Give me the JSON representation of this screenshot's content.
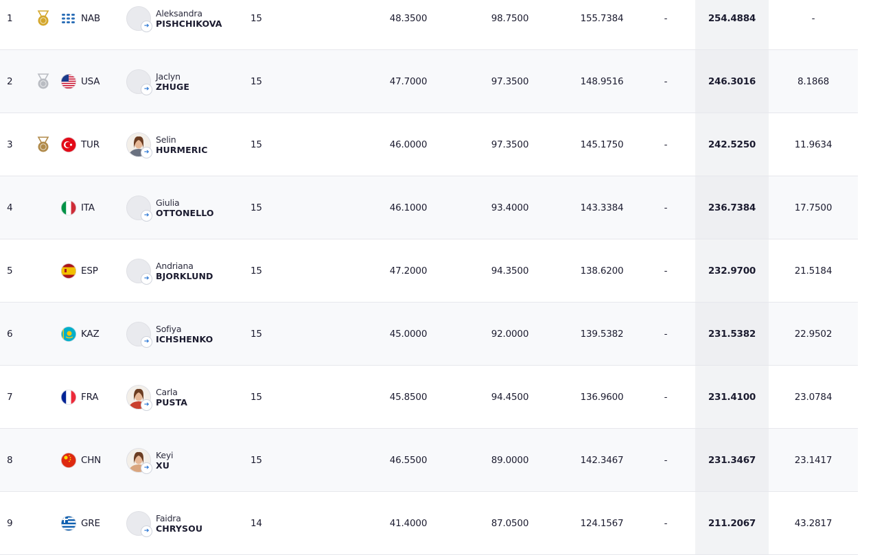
{
  "columns": [
    "rank",
    "medal",
    "noc",
    "athlete",
    "age",
    "score1",
    "score2",
    "score3",
    "penalty",
    "total",
    "behind"
  ],
  "rows": [
    {
      "rank": "1",
      "medal": "gold",
      "noc": "NAB",
      "flag": "nab-flag-icon",
      "first": "Aleksandra",
      "last": "PISHCHIKOVA",
      "age": "15",
      "s1": "48.3500",
      "s2": "98.7500",
      "s3": "155.7384",
      "pen": "-",
      "total": "254.4884",
      "behind": "-",
      "photo": false
    },
    {
      "rank": "2",
      "medal": "silver",
      "noc": "USA",
      "flag": "usa-flag-icon",
      "first": "Jaclyn",
      "last": "ZHUGE",
      "age": "15",
      "s1": "47.7000",
      "s2": "97.3500",
      "s3": "148.9516",
      "pen": "-",
      "total": "246.3016",
      "behind": "8.1868",
      "photo": false
    },
    {
      "rank": "3",
      "medal": "bronze",
      "noc": "TUR",
      "flag": "tur-flag-icon",
      "first": "Selin",
      "last": "HURMERIC",
      "age": "15",
      "s1": "46.0000",
      "s2": "97.3500",
      "s3": "145.1750",
      "pen": "-",
      "total": "242.5250",
      "behind": "11.9634",
      "photo": true
    },
    {
      "rank": "4",
      "medal": "",
      "noc": "ITA",
      "flag": "ita-flag-icon",
      "first": "Giulia",
      "last": "OTTONELLO",
      "age": "15",
      "s1": "46.1000",
      "s2": "93.4000",
      "s3": "143.3384",
      "pen": "-",
      "total": "236.7384",
      "behind": "17.7500",
      "photo": false
    },
    {
      "rank": "5",
      "medal": "",
      "noc": "ESP",
      "flag": "esp-flag-icon",
      "first": "Andriana",
      "last": "BJORKLUND",
      "age": "15",
      "s1": "47.2000",
      "s2": "94.3500",
      "s3": "138.6200",
      "pen": "-",
      "total": "232.9700",
      "behind": "21.5184",
      "photo": false
    },
    {
      "rank": "6",
      "medal": "",
      "noc": "KAZ",
      "flag": "kaz-flag-icon",
      "first": "Sofiya",
      "last": "ICHSHENKO",
      "age": "15",
      "s1": "45.0000",
      "s2": "92.0000",
      "s3": "139.5382",
      "pen": "-",
      "total": "231.5382",
      "behind": "22.9502",
      "photo": false
    },
    {
      "rank": "7",
      "medal": "",
      "noc": "FRA",
      "flag": "fra-flag-icon",
      "first": "Carla",
      "last": "PUSTA",
      "age": "15",
      "s1": "45.8500",
      "s2": "94.4500",
      "s3": "136.9600",
      "pen": "-",
      "total": "231.4100",
      "behind": "23.0784",
      "photo": true
    },
    {
      "rank": "8",
      "medal": "",
      "noc": "CHN",
      "flag": "chn-flag-icon",
      "first": "Keyi",
      "last": "XU",
      "age": "15",
      "s1": "46.5500",
      "s2": "89.0000",
      "s3": "142.3467",
      "pen": "-",
      "total": "231.3467",
      "behind": "23.1417",
      "photo": true
    },
    {
      "rank": "9",
      "medal": "",
      "noc": "GRE",
      "flag": "gre-flag-icon",
      "first": "Faidra",
      "last": "CHRYSOU",
      "age": "14",
      "s1": "41.4000",
      "s2": "87.0500",
      "s3": "124.1567",
      "pen": "-",
      "total": "211.2067",
      "behind": "43.2817",
      "photo": false
    }
  ],
  "colors": {
    "gold": "#d4a72c",
    "silver": "#b9bcc2",
    "bronze": "#b08a4a",
    "border": "#e6e7ec",
    "total_bg": "#f2f3f5"
  }
}
